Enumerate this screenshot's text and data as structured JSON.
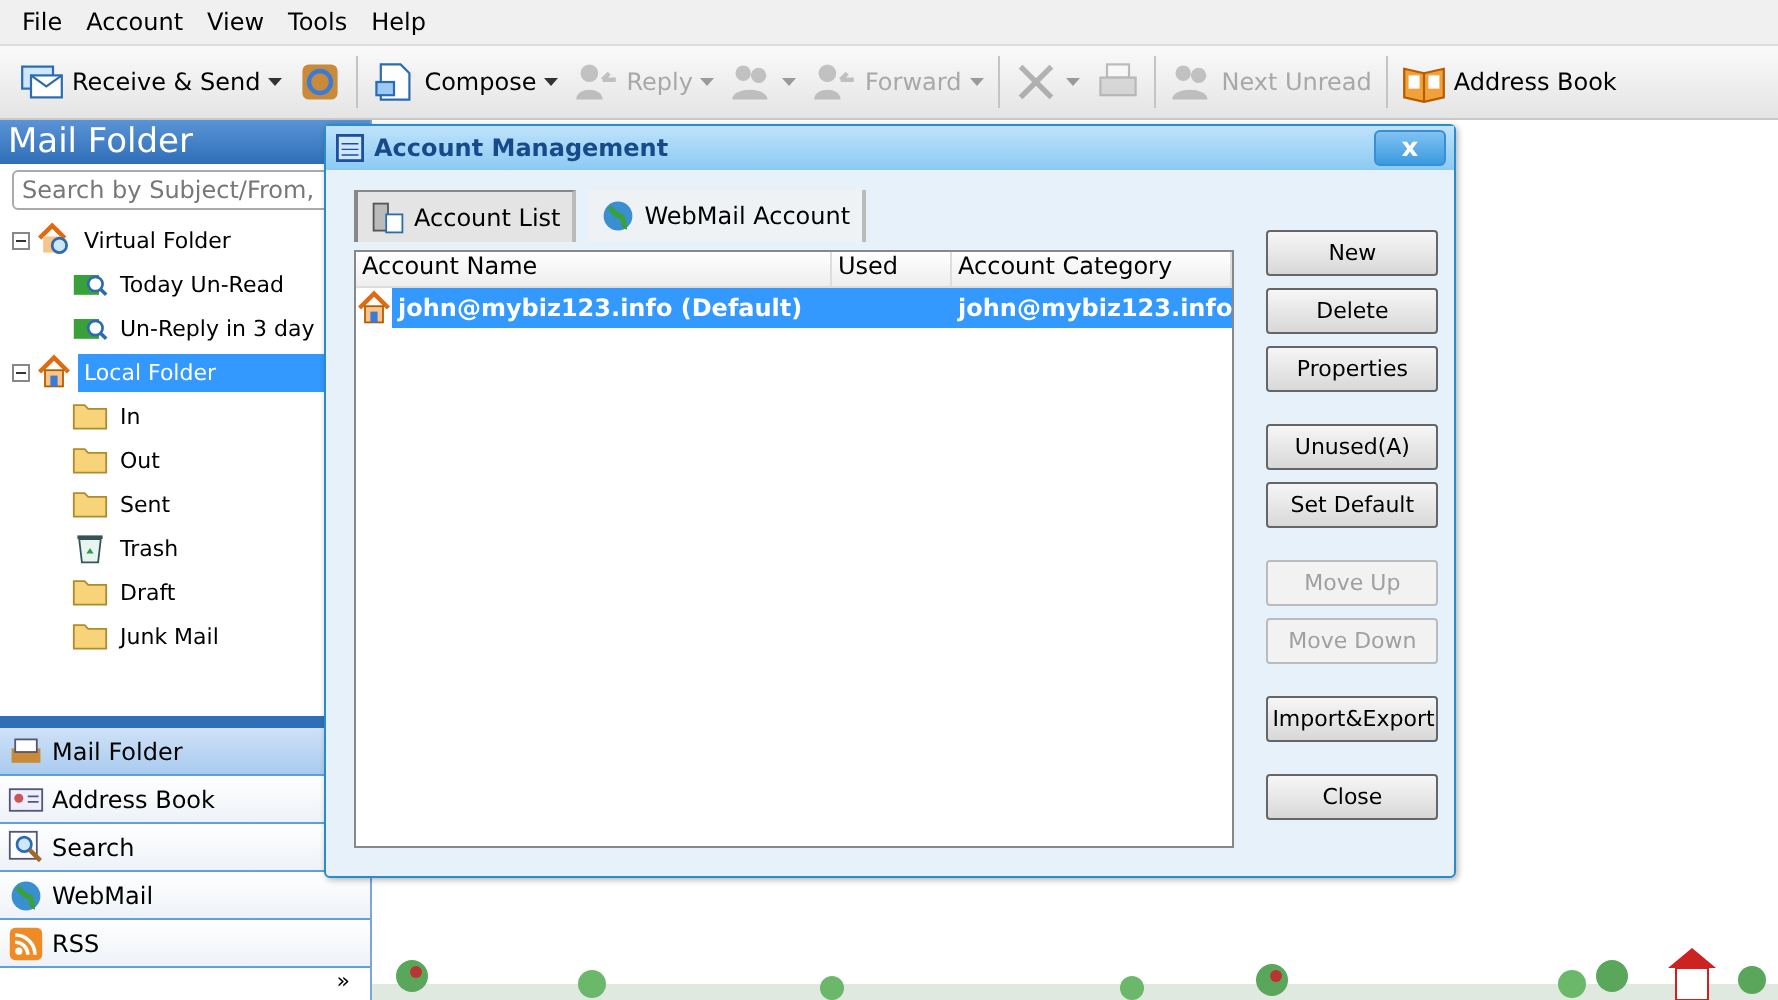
{
  "menu": [
    "File",
    "Account",
    "View",
    "Tools",
    "Help"
  ],
  "toolbar": [
    {
      "label": "Receive & Send",
      "disabled": false,
      "dropdown": true
    },
    {
      "disabled": false,
      "dropdown": false
    },
    {
      "label": "Compose",
      "disabled": false,
      "dropdown": true
    },
    {
      "label": "Reply",
      "disabled": true,
      "dropdown": true
    },
    {
      "disabled": true,
      "dropdown": true
    },
    {
      "label": "Forward",
      "disabled": true,
      "dropdown": true
    },
    {
      "disabled": true,
      "dropdown": true
    },
    {
      "disabled": true,
      "dropdown": false
    },
    {
      "label": "Next Unread",
      "disabled": true,
      "dropdown": false
    },
    {
      "label": "Address Book",
      "disabled": false,
      "dropdown": false
    }
  ],
  "sidebar": {
    "title": "Mail Folder",
    "search": {
      "placeholder": "Search by Subject/From,"
    },
    "tree": [
      {
        "label": "Virtual Folder",
        "expanded": true,
        "selected": false,
        "children": [
          {
            "label": "Today Un-Read",
            "selected": false
          },
          {
            "label": "Un-Reply in 3 day",
            "selected": false
          }
        ]
      },
      {
        "label": "Local Folder",
        "expanded": true,
        "selected": true,
        "children": [
          {
            "label": "In",
            "selected": false
          },
          {
            "label": "Out",
            "selected": false
          },
          {
            "label": "Sent",
            "selected": false
          },
          {
            "label": "Trash",
            "selected": false
          },
          {
            "label": "Draft",
            "selected": false
          },
          {
            "label": "Junk Mail",
            "selected": false
          }
        ]
      }
    ],
    "nav": [
      {
        "label": "Mail Folder",
        "selected": true
      },
      {
        "label": "Address Book",
        "selected": false
      },
      {
        "label": "Search",
        "selected": false
      },
      {
        "label": "WebMail",
        "selected": false
      },
      {
        "label": "RSS",
        "selected": false
      }
    ],
    "more": "»"
  },
  "dialog": {
    "title": "Account Management",
    "close": "x",
    "tabs": [
      {
        "label": "Account List",
        "selected": true
      },
      {
        "label": "WebMail Account",
        "selected": false
      }
    ],
    "columns": [
      "Account Name",
      "Used",
      "Account Category"
    ],
    "rows": [
      {
        "cells": [
          "john@mybiz123.info (Default)",
          "",
          "john@mybiz123.info"
        ],
        "selected": true
      }
    ],
    "buttons": [
      {
        "label": "New",
        "disabled": false
      },
      {
        "label": "Delete",
        "disabled": false
      },
      {
        "label": "Properties",
        "disabled": false
      },
      {
        "label": "Unused(A)",
        "disabled": false
      },
      {
        "label": "Set Default",
        "disabled": false
      },
      {
        "label": "Move Up",
        "disabled": true
      },
      {
        "label": "Move Down",
        "disabled": true
      },
      {
        "label": "Import&Export",
        "disabled": false
      },
      {
        "label": "Close",
        "disabled": false
      }
    ]
  }
}
